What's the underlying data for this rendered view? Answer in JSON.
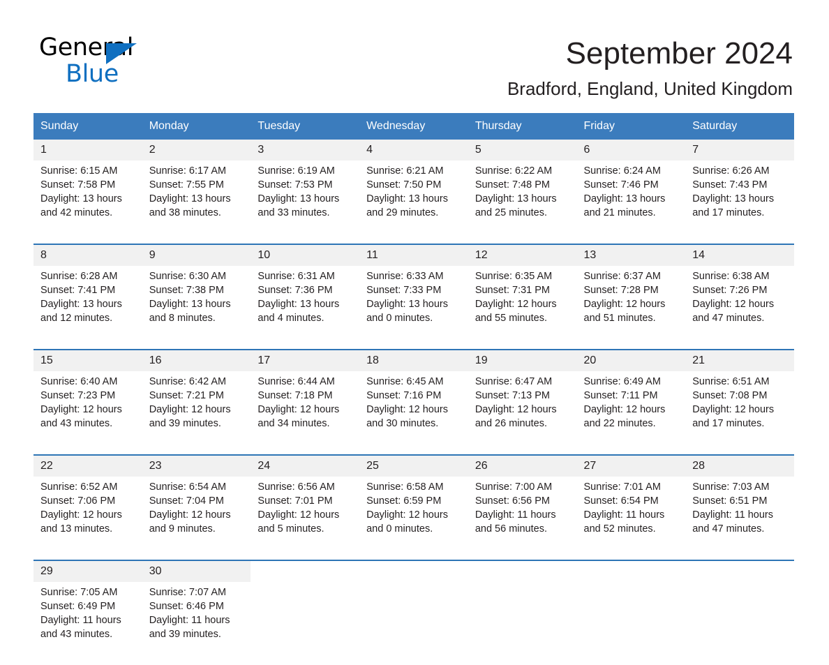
{
  "brand": {
    "name_part1": "General",
    "name_part2": "Blue",
    "accent_color": "#0f6fc0"
  },
  "header": {
    "title": "September 2024",
    "location": "Bradford, England, United Kingdom"
  },
  "colors": {
    "header_blue": "#3b7cbd",
    "row_separator": "#2e75b6",
    "daynum_bg": "#f1f1f1",
    "text": "#231f20"
  },
  "weekday_headers": [
    "Sunday",
    "Monday",
    "Tuesday",
    "Wednesday",
    "Thursday",
    "Friday",
    "Saturday"
  ],
  "weeks": [
    {
      "days": [
        {
          "date": "1",
          "sunrise": "Sunrise: 6:15 AM",
          "sunset": "Sunset: 7:58 PM",
          "daylight_line1": "Daylight: 13 hours",
          "daylight_line2": "and 42 minutes."
        },
        {
          "date": "2",
          "sunrise": "Sunrise: 6:17 AM",
          "sunset": "Sunset: 7:55 PM",
          "daylight_line1": "Daylight: 13 hours",
          "daylight_line2": "and 38 minutes."
        },
        {
          "date": "3",
          "sunrise": "Sunrise: 6:19 AM",
          "sunset": "Sunset: 7:53 PM",
          "daylight_line1": "Daylight: 13 hours",
          "daylight_line2": "and 33 minutes."
        },
        {
          "date": "4",
          "sunrise": "Sunrise: 6:21 AM",
          "sunset": "Sunset: 7:50 PM",
          "daylight_line1": "Daylight: 13 hours",
          "daylight_line2": "and 29 minutes."
        },
        {
          "date": "5",
          "sunrise": "Sunrise: 6:22 AM",
          "sunset": "Sunset: 7:48 PM",
          "daylight_line1": "Daylight: 13 hours",
          "daylight_line2": "and 25 minutes."
        },
        {
          "date": "6",
          "sunrise": "Sunrise: 6:24 AM",
          "sunset": "Sunset: 7:46 PM",
          "daylight_line1": "Daylight: 13 hours",
          "daylight_line2": "and 21 minutes."
        },
        {
          "date": "7",
          "sunrise": "Sunrise: 6:26 AM",
          "sunset": "Sunset: 7:43 PM",
          "daylight_line1": "Daylight: 13 hours",
          "daylight_line2": "and 17 minutes."
        }
      ]
    },
    {
      "days": [
        {
          "date": "8",
          "sunrise": "Sunrise: 6:28 AM",
          "sunset": "Sunset: 7:41 PM",
          "daylight_line1": "Daylight: 13 hours",
          "daylight_line2": "and 12 minutes."
        },
        {
          "date": "9",
          "sunrise": "Sunrise: 6:30 AM",
          "sunset": "Sunset: 7:38 PM",
          "daylight_line1": "Daylight: 13 hours",
          "daylight_line2": "and 8 minutes."
        },
        {
          "date": "10",
          "sunrise": "Sunrise: 6:31 AM",
          "sunset": "Sunset: 7:36 PM",
          "daylight_line1": "Daylight: 13 hours",
          "daylight_line2": "and 4 minutes."
        },
        {
          "date": "11",
          "sunrise": "Sunrise: 6:33 AM",
          "sunset": "Sunset: 7:33 PM",
          "daylight_line1": "Daylight: 13 hours",
          "daylight_line2": "and 0 minutes."
        },
        {
          "date": "12",
          "sunrise": "Sunrise: 6:35 AM",
          "sunset": "Sunset: 7:31 PM",
          "daylight_line1": "Daylight: 12 hours",
          "daylight_line2": "and 55 minutes."
        },
        {
          "date": "13",
          "sunrise": "Sunrise: 6:37 AM",
          "sunset": "Sunset: 7:28 PM",
          "daylight_line1": "Daylight: 12 hours",
          "daylight_line2": "and 51 minutes."
        },
        {
          "date": "14",
          "sunrise": "Sunrise: 6:38 AM",
          "sunset": "Sunset: 7:26 PM",
          "daylight_line1": "Daylight: 12 hours",
          "daylight_line2": "and 47 minutes."
        }
      ]
    },
    {
      "days": [
        {
          "date": "15",
          "sunrise": "Sunrise: 6:40 AM",
          "sunset": "Sunset: 7:23 PM",
          "daylight_line1": "Daylight: 12 hours",
          "daylight_line2": "and 43 minutes."
        },
        {
          "date": "16",
          "sunrise": "Sunrise: 6:42 AM",
          "sunset": "Sunset: 7:21 PM",
          "daylight_line1": "Daylight: 12 hours",
          "daylight_line2": "and 39 minutes."
        },
        {
          "date": "17",
          "sunrise": "Sunrise: 6:44 AM",
          "sunset": "Sunset: 7:18 PM",
          "daylight_line1": "Daylight: 12 hours",
          "daylight_line2": "and 34 minutes."
        },
        {
          "date": "18",
          "sunrise": "Sunrise: 6:45 AM",
          "sunset": "Sunset: 7:16 PM",
          "daylight_line1": "Daylight: 12 hours",
          "daylight_line2": "and 30 minutes."
        },
        {
          "date": "19",
          "sunrise": "Sunrise: 6:47 AM",
          "sunset": "Sunset: 7:13 PM",
          "daylight_line1": "Daylight: 12 hours",
          "daylight_line2": "and 26 minutes."
        },
        {
          "date": "20",
          "sunrise": "Sunrise: 6:49 AM",
          "sunset": "Sunset: 7:11 PM",
          "daylight_line1": "Daylight: 12 hours",
          "daylight_line2": "and 22 minutes."
        },
        {
          "date": "21",
          "sunrise": "Sunrise: 6:51 AM",
          "sunset": "Sunset: 7:08 PM",
          "daylight_line1": "Daylight: 12 hours",
          "daylight_line2": "and 17 minutes."
        }
      ]
    },
    {
      "days": [
        {
          "date": "22",
          "sunrise": "Sunrise: 6:52 AM",
          "sunset": "Sunset: 7:06 PM",
          "daylight_line1": "Daylight: 12 hours",
          "daylight_line2": "and 13 minutes."
        },
        {
          "date": "23",
          "sunrise": "Sunrise: 6:54 AM",
          "sunset": "Sunset: 7:04 PM",
          "daylight_line1": "Daylight: 12 hours",
          "daylight_line2": "and 9 minutes."
        },
        {
          "date": "24",
          "sunrise": "Sunrise: 6:56 AM",
          "sunset": "Sunset: 7:01 PM",
          "daylight_line1": "Daylight: 12 hours",
          "daylight_line2": "and 5 minutes."
        },
        {
          "date": "25",
          "sunrise": "Sunrise: 6:58 AM",
          "sunset": "Sunset: 6:59 PM",
          "daylight_line1": "Daylight: 12 hours",
          "daylight_line2": "and 0 minutes."
        },
        {
          "date": "26",
          "sunrise": "Sunrise: 7:00 AM",
          "sunset": "Sunset: 6:56 PM",
          "daylight_line1": "Daylight: 11 hours",
          "daylight_line2": "and 56 minutes."
        },
        {
          "date": "27",
          "sunrise": "Sunrise: 7:01 AM",
          "sunset": "Sunset: 6:54 PM",
          "daylight_line1": "Daylight: 11 hours",
          "daylight_line2": "and 52 minutes."
        },
        {
          "date": "28",
          "sunrise": "Sunrise: 7:03 AM",
          "sunset": "Sunset: 6:51 PM",
          "daylight_line1": "Daylight: 11 hours",
          "daylight_line2": "and 47 minutes."
        }
      ]
    },
    {
      "days": [
        {
          "date": "29",
          "sunrise": "Sunrise: 7:05 AM",
          "sunset": "Sunset: 6:49 PM",
          "daylight_line1": "Daylight: 11 hours",
          "daylight_line2": "and 43 minutes."
        },
        {
          "date": "30",
          "sunrise": "Sunrise: 7:07 AM",
          "sunset": "Sunset: 6:46 PM",
          "daylight_line1": "Daylight: 11 hours",
          "daylight_line2": "and 39 minutes."
        },
        {
          "date": "",
          "sunrise": "",
          "sunset": "",
          "daylight_line1": "",
          "daylight_line2": ""
        },
        {
          "date": "",
          "sunrise": "",
          "sunset": "",
          "daylight_line1": "",
          "daylight_line2": ""
        },
        {
          "date": "",
          "sunrise": "",
          "sunset": "",
          "daylight_line1": "",
          "daylight_line2": ""
        },
        {
          "date": "",
          "sunrise": "",
          "sunset": "",
          "daylight_line1": "",
          "daylight_line2": ""
        },
        {
          "date": "",
          "sunrise": "",
          "sunset": "",
          "daylight_line1": "",
          "daylight_line2": ""
        }
      ]
    }
  ]
}
